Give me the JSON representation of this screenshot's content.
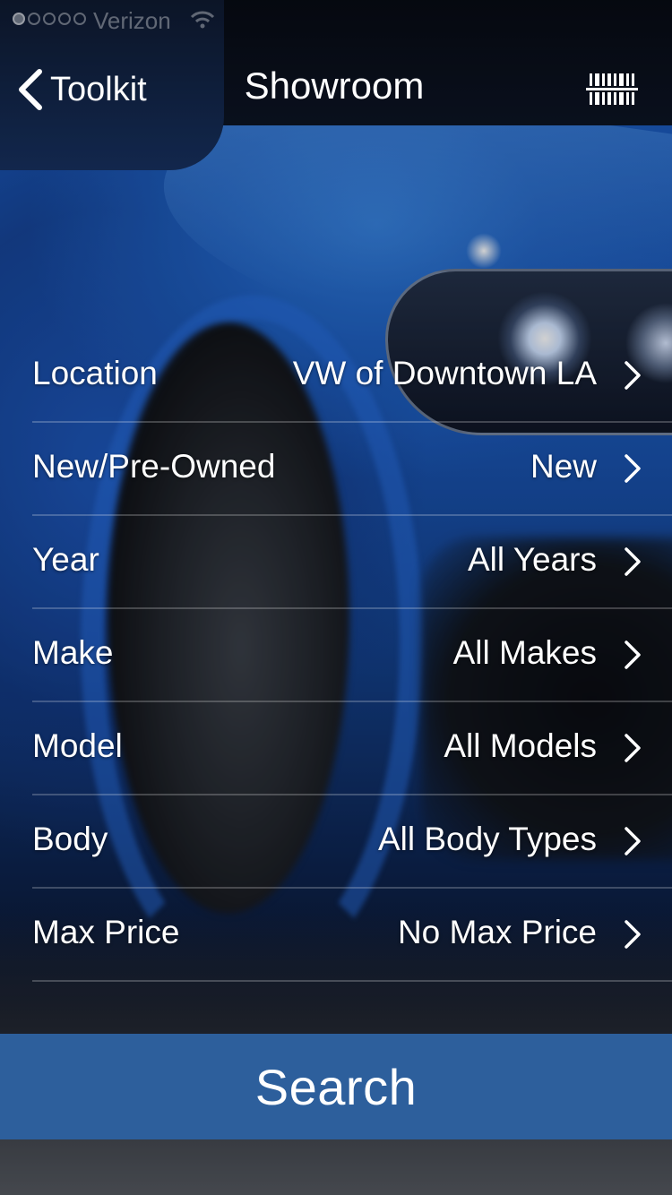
{
  "status_bar": {
    "carrier": "Verizon",
    "signal_bars": 1,
    "signal_total": 5,
    "wifi": "wifi-icon"
  },
  "nav": {
    "back_label": "Toolkit",
    "back_icon": "chevron-left-icon",
    "title": "Showroom",
    "right_icon": "barcode-scan-icon"
  },
  "filters": [
    {
      "label": "Location",
      "value": "VW of Downtown LA"
    },
    {
      "label": "New/Pre-Owned",
      "value": "New"
    },
    {
      "label": "Year",
      "value": "All Years"
    },
    {
      "label": "Make",
      "value": "All Makes"
    },
    {
      "label": "Model",
      "value": "All Models"
    },
    {
      "label": "Body",
      "value": "All Body Types"
    },
    {
      "label": "Max Price",
      "value": "No Max Price"
    }
  ],
  "search": {
    "label": "Search"
  },
  "colors": {
    "search_button": "#2d5f9c",
    "text": "#ffffff",
    "divider": "rgba(255,255,255,0.22)"
  }
}
